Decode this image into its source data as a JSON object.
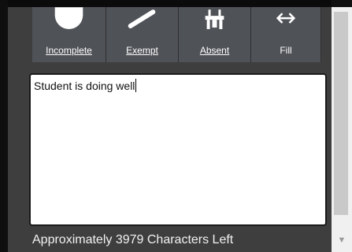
{
  "toolbar": {
    "buttons": [
      {
        "label": "Incomplete",
        "underlined_letter": "I",
        "icon": "half-circle-icon"
      },
      {
        "label": "Exempt",
        "underlined_letter": "E",
        "icon": "slash-icon"
      },
      {
        "label": "Absent",
        "underlined_letter": "A",
        "icon": "seat-icon"
      },
      {
        "label": "Fill",
        "underlined_letter": "",
        "icon": "left-right-arrow-icon"
      }
    ]
  },
  "notes": {
    "value": "Student is doing well"
  },
  "status": {
    "characters_left": "Approximately 3979 Characters Left"
  },
  "colors": {
    "background": "#3e3e3e",
    "button": "#4f5257",
    "text_light": "#ffffff"
  }
}
